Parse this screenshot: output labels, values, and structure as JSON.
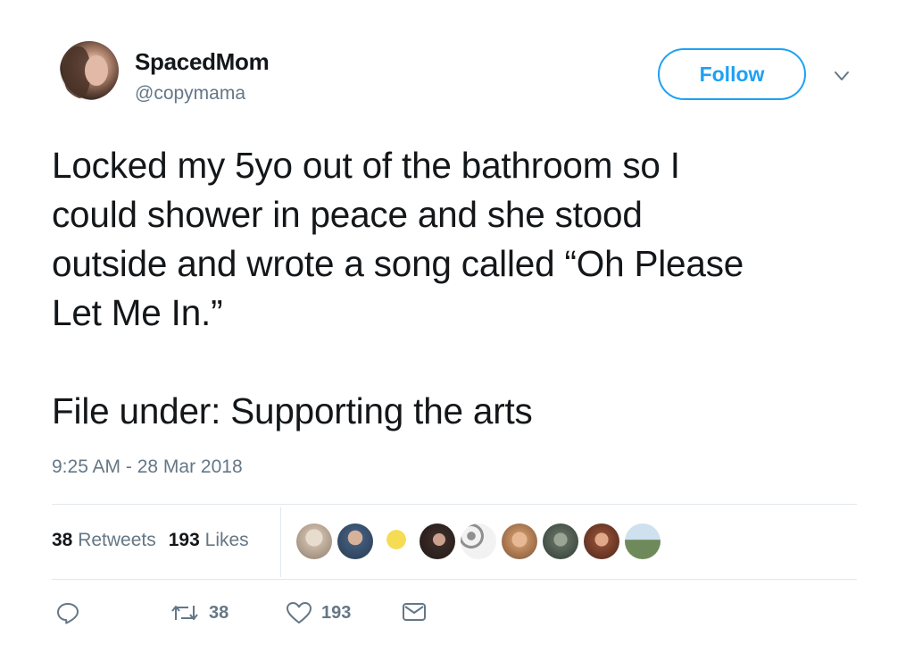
{
  "user": {
    "display_name": "SpacedMom",
    "handle": "@copymama"
  },
  "follow_label": "Follow",
  "tweet": {
    "text": "Locked my 5yo out of the bathroom so I\ncould shower in peace and she stood\noutside and wrote a song called “Oh Please\nLet Me In.”\n\nFile under: Supporting the arts",
    "timestamp": "9:25 AM - 28 Mar 2018"
  },
  "stats": {
    "retweets_count": "38",
    "retweets_label": "Retweets",
    "likes_count": "193",
    "likes_label": "Likes"
  },
  "liker_avatars": [
    {
      "icon": "avatar-1",
      "color": "#c9b7a6"
    },
    {
      "icon": "avatar-2",
      "color": "#3f5a7a"
    },
    {
      "icon": "avatar-3",
      "color": "#f2d24b"
    },
    {
      "icon": "avatar-4",
      "color": "#3a2b27"
    },
    {
      "icon": "avatar-5",
      "color": "#bdbdbd"
    },
    {
      "icon": "avatar-6",
      "color": "#c48f62"
    },
    {
      "icon": "avatar-7",
      "color": "#5f6b5e"
    },
    {
      "icon": "avatar-8",
      "color": "#8a4a32"
    },
    {
      "icon": "avatar-9",
      "color": "#6f8a5a"
    }
  ],
  "actions": {
    "reply_icon": "reply-icon",
    "retweet_count": "38",
    "like_count": "193",
    "dm_icon": "envelope-icon"
  },
  "colors": {
    "accent": "#1da1f2",
    "secondary_text": "#657786",
    "divider": "#e1e8ed"
  }
}
